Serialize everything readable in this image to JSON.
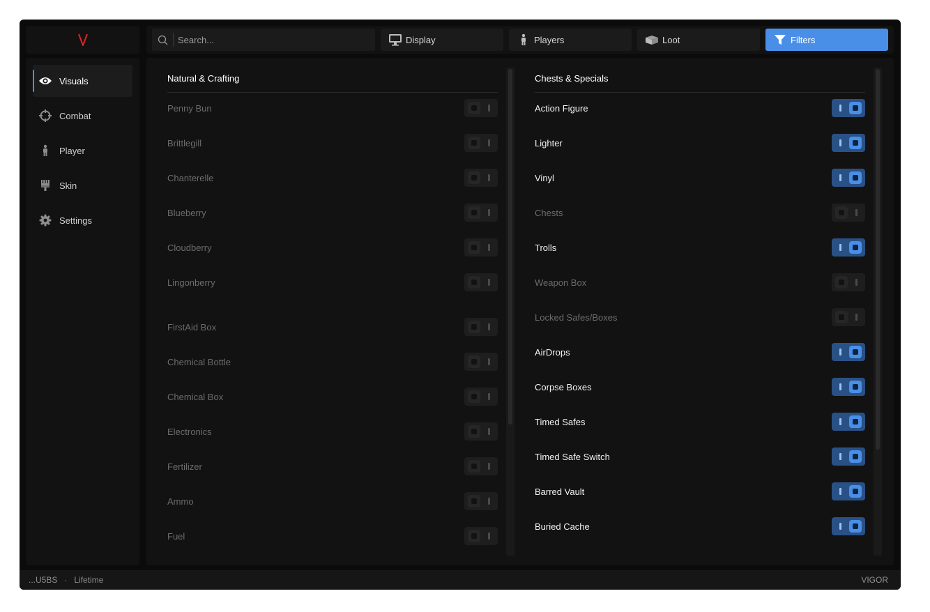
{
  "brand": {
    "logo_letter": "V",
    "logo_color": "#e02424",
    "name": "VIGOR"
  },
  "search": {
    "placeholder": "Search..."
  },
  "tabs": [
    {
      "label": "Display",
      "icon": "monitor-icon"
    },
    {
      "label": "Players",
      "icon": "person-icon"
    },
    {
      "label": "Loot",
      "icon": "box-icon"
    },
    {
      "label": "Filters",
      "icon": "filter-icon",
      "active": true
    }
  ],
  "sidebar": {
    "items": [
      {
        "label": "Visuals",
        "icon": "eye-icon",
        "active": true
      },
      {
        "label": "Combat",
        "icon": "crosshair-icon"
      },
      {
        "label": "Player",
        "icon": "person-icon"
      },
      {
        "label": "Skin",
        "icon": "brush-icon"
      },
      {
        "label": "Settings",
        "icon": "gear-icon"
      }
    ]
  },
  "sections": {
    "left": {
      "title": "Natural & Crafting",
      "items": [
        {
          "label": "Penny Bun",
          "enabled": false
        },
        {
          "label": "Brittlegill",
          "enabled": false
        },
        {
          "label": "Chanterelle",
          "enabled": false
        },
        {
          "label": "Blueberry",
          "enabled": false
        },
        {
          "label": "Cloudberry",
          "enabled": false
        },
        {
          "label": "Lingonberry",
          "enabled": false
        },
        {
          "label": "FirstAid Box",
          "enabled": false
        },
        {
          "label": "Chemical Bottle",
          "enabled": false
        },
        {
          "label": "Chemical Box",
          "enabled": false
        },
        {
          "label": "Electronics",
          "enabled": false
        },
        {
          "label": "Fertilizer",
          "enabled": false
        },
        {
          "label": "Ammo",
          "enabled": false
        },
        {
          "label": "Fuel",
          "enabled": false
        }
      ]
    },
    "right": {
      "title": "Chests & Specials",
      "items": [
        {
          "label": "Action Figure",
          "enabled": true
        },
        {
          "label": "Lighter",
          "enabled": true
        },
        {
          "label": "Vinyl",
          "enabled": true
        },
        {
          "label": "Chests",
          "enabled": false
        },
        {
          "label": "Trolls",
          "enabled": true
        },
        {
          "label": "Weapon Box",
          "enabled": false
        },
        {
          "label": "Locked Safes/Boxes",
          "enabled": false
        },
        {
          "label": "AirDrops",
          "enabled": true
        },
        {
          "label": "Corpse Boxes",
          "enabled": true
        },
        {
          "label": "Timed Safes",
          "enabled": true
        },
        {
          "label": "Timed Safe Switch",
          "enabled": true
        },
        {
          "label": "Barred Vault",
          "enabled": true
        },
        {
          "label": "Buried Cache",
          "enabled": true
        }
      ]
    }
  },
  "footer": {
    "key": "...U5BS",
    "separator": "·",
    "plan": "Lifetime",
    "brand": "VIGOR"
  },
  "colors": {
    "accent": "#4a8fe7",
    "toggle_on_bg": "#2a5186",
    "background": "#0b0b0b",
    "panel": "#121212"
  }
}
